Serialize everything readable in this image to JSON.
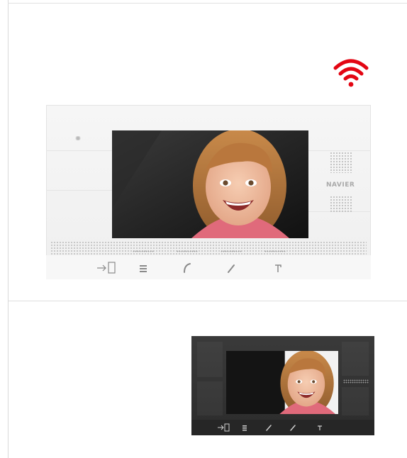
{
  "brand": {
    "text": "NAVIER"
  },
  "colors": {
    "wifi": "#e30613",
    "monitor_white": "#f2f2f2",
    "monitor_dark": "#333333"
  },
  "icons": {
    "wifi": "wifi-icon",
    "door": "door-open-icon",
    "menu": "menu-icon",
    "answer": "phone-answer-icon",
    "talk": "phone-hangup-icon",
    "unlock": "unlock-icon"
  }
}
